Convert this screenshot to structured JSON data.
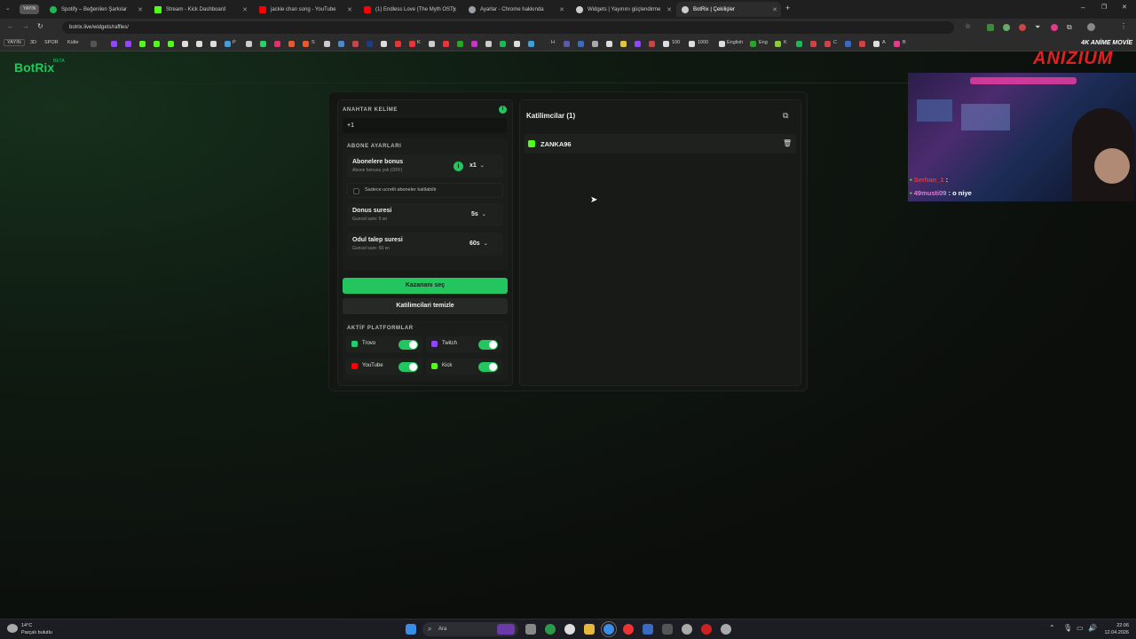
{
  "browser": {
    "badge": "YAYIN",
    "tabs": [
      {
        "label": "Spotify – Beğenilen Şarkılar",
        "color": "#1db954"
      },
      {
        "label": "Stream - Kick Dashboard",
        "color": "#53fc18"
      },
      {
        "label": "jackie chan song - YouTube",
        "color": "#ff0000"
      },
      {
        "label": "(1) Endless Love (The Myth OST)",
        "color": "#ff0000"
      },
      {
        "label": "Ayarlar - Chrome hakkında",
        "color": "#9aa0a6"
      },
      {
        "label": "Widgets | Yayınını güçlendirme",
        "color": "#cccccc"
      },
      {
        "label": "BotRix | Çekilişler",
        "color": "#cccccc"
      }
    ],
    "url": "botrix.live/widgets/raffles/",
    "bookmarks": [
      "YAYIN",
      "3D",
      "SPOR",
      "Kütle",
      "P",
      "S",
      "K",
      "H",
      "100",
      "1000",
      "English",
      "Eng",
      "K",
      "C",
      "A",
      "B"
    ]
  },
  "app": {
    "logo": "BotRix",
    "beta": "BETA"
  },
  "raffle": {
    "keyword_label": "ANAHTAR KELİME",
    "keyword_value": "+1",
    "sub_settings_label": "ABONE AYARLARI",
    "sub_bonus_title": "Abonelere bonus",
    "sub_bonus_sub": "Abone bonusu yok (OFF)",
    "sub_bonus_value": "x1",
    "sub_only_label": "Sadece ucretli aboneler katilabilir",
    "bonus_time_title": "Donus suresi",
    "bonus_time_sub": "Guncel sure: 5 sn",
    "bonus_time_value": "5s",
    "claim_time_title": "Odul talep suresi",
    "claim_time_sub": "Guncel sure: 60 sn",
    "claim_time_value": "60s",
    "pick_winner": "Kazananı seç",
    "clear_participants": "Katilimcilari temizle",
    "platforms_label": "AKTİF PLATFORMLAR",
    "platforms": [
      {
        "name": "Trovo",
        "color": "#1fd16d",
        "enabled": true
      },
      {
        "name": "Twitch",
        "color": "#9146ff",
        "enabled": true
      },
      {
        "name": "YouTube",
        "color": "#ff0000",
        "enabled": true
      },
      {
        "name": "Kick",
        "color": "#53fc18",
        "enabled": true
      }
    ],
    "participants_title": "Katilimcilar (1)",
    "participants": [
      {
        "name": "ZANKA96",
        "platform": "Kick"
      }
    ]
  },
  "overlay": {
    "brand_top": "4K ANİME MOVİE",
    "brand": "ANIZIUM",
    "chat": [
      {
        "user": "Serhan_1",
        "text": ":"
      },
      {
        "user": "49musti09",
        "text": ": o niye"
      }
    ]
  },
  "taskbar": {
    "weather_temp": "14°C",
    "weather_desc": "Parçalı bulutlu",
    "search": "Ara",
    "time": "22:06",
    "date": "12.04.2026"
  },
  "colors": {
    "accent": "#22c55e",
    "panel": "#141614"
  }
}
